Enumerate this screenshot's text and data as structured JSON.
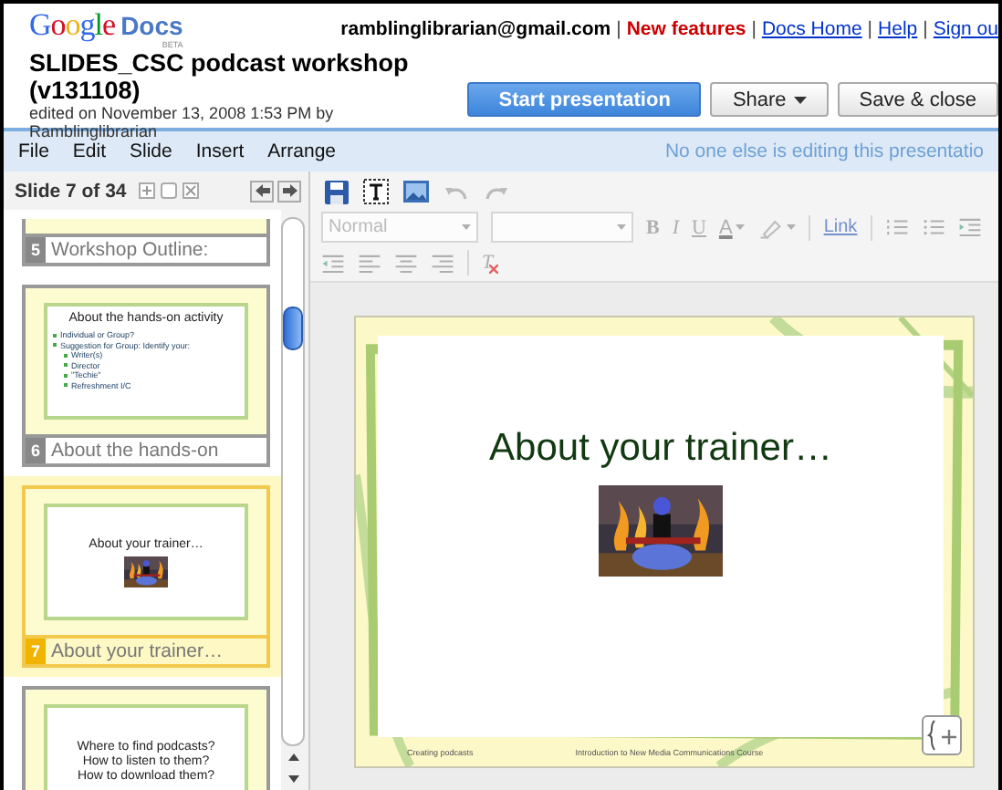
{
  "header": {
    "logo": {
      "brand": "Google",
      "product": "Docs",
      "badge": "BETA"
    },
    "account_links": [
      {
        "text": "ramblinglibrarian@gmail.com",
        "kind": "user"
      },
      {
        "text": "|",
        "kind": "separator"
      },
      {
        "text": "New features",
        "kind": "alert"
      },
      {
        "text": "|",
        "kind": "separator"
      },
      {
        "text": "Docs Home",
        "kind": "link"
      },
      {
        "text": "|",
        "kind": "separator"
      },
      {
        "text": "Help",
        "kind": "link"
      },
      {
        "text": "|",
        "kind": "separator"
      },
      {
        "text": "Sign ou",
        "kind": "link"
      }
    ],
    "document": {
      "title": "SLIDES_CSC podcast workshop (v131108)",
      "edited": "edited on November 13, 2008 1:53 PM by",
      "author": "Ramblinglibrarian"
    },
    "buttons": [
      {
        "label": "Start presentation",
        "kind": "primary"
      },
      {
        "label": "Share",
        "kind": "menu"
      },
      {
        "label": "Save & close",
        "kind": "plain"
      }
    ]
  },
  "menu": {
    "items": [
      "File",
      "Edit",
      "Slide",
      "Insert",
      "Arrange"
    ],
    "status": "No one else is editing this presentatio"
  },
  "slide_panel": {
    "counter": "Slide 7 of 34",
    "slides": [
      {
        "number": "5",
        "caption": "Workshop Outline:",
        "selected": false,
        "kind": "cut"
      },
      {
        "number": "6",
        "caption": "About the hands-on",
        "selected": false,
        "kind": "bullets",
        "title": "About the hands-on activity",
        "bullets": [
          {
            "text": "Individual or Group?"
          },
          {
            "text": "Suggestion for Group: Identify your:",
            "children": [
              {
                "text": "Writer(s)"
              },
              {
                "text": "Director"
              },
              {
                "text": "\"Techie\""
              },
              {
                "text": "Refreshment I/C"
              }
            ]
          }
        ]
      },
      {
        "number": "7",
        "caption": "About your trainer…",
        "selected": true,
        "kind": "picture",
        "title": "About your trainer…"
      },
      {
        "selected": false,
        "kind": "lines",
        "lines": [
          "Where to find podcasts?",
          "How to listen to them?",
          "How to download them?"
        ]
      }
    ]
  },
  "toolbar": {
    "disabled": true,
    "format": [
      {
        "kind": "select",
        "value": "Normal"
      },
      {
        "kind": "select"
      },
      {
        "kind": "bold",
        "label": "B"
      },
      {
        "kind": "italic",
        "label": "I"
      },
      {
        "kind": "underline",
        "label": "U"
      },
      {
        "kind": "color",
        "label": "A"
      },
      {
        "kind": "highlight"
      },
      {
        "kind": "separator"
      },
      {
        "kind": "link",
        "label": "Link"
      },
      {
        "kind": "separator"
      },
      {
        "kind": "numbered-list"
      },
      {
        "kind": "bullet-list"
      },
      {
        "kind": "indent"
      },
      {
        "kind": "outdent"
      },
      {
        "kind": "align-left"
      },
      {
        "kind": "align-center"
      },
      {
        "kind": "align-right"
      },
      {
        "kind": "separator"
      },
      {
        "kind": "clear-format",
        "label": "T"
      }
    ]
  },
  "slide": {
    "title": "About your trainer…",
    "footer_left": "Creating podcasts",
    "footer_center": "Introduction to New Media Communications Course"
  }
}
